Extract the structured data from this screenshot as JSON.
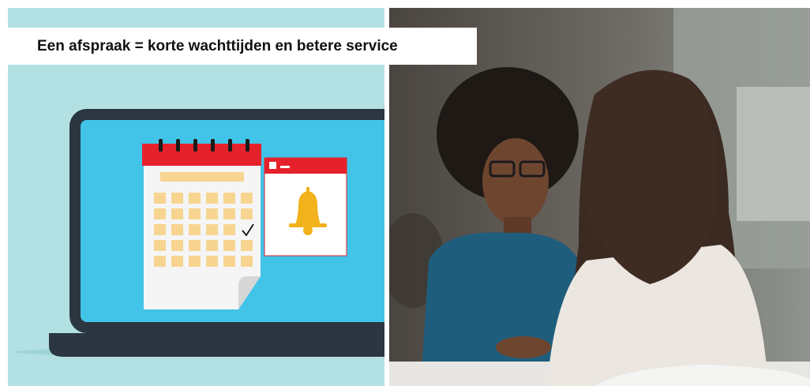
{
  "banner": {
    "headline": "Een afspraak = korte wachttijden en betere service"
  },
  "illustration": {
    "icons": [
      "laptop-icon",
      "calendar-icon",
      "checkmark-icon",
      "notification-window-icon",
      "bell-icon"
    ],
    "colors": {
      "background": "#b2e0e3",
      "laptop_frame": "#2b3640",
      "laptop_screen": "#42c3e8",
      "calendar_header": "#e5222b",
      "calendar_cells": "#f7d591",
      "bell": "#f2b21b"
    }
  },
  "photo": {
    "subject": "photo-two-women-meeting"
  }
}
